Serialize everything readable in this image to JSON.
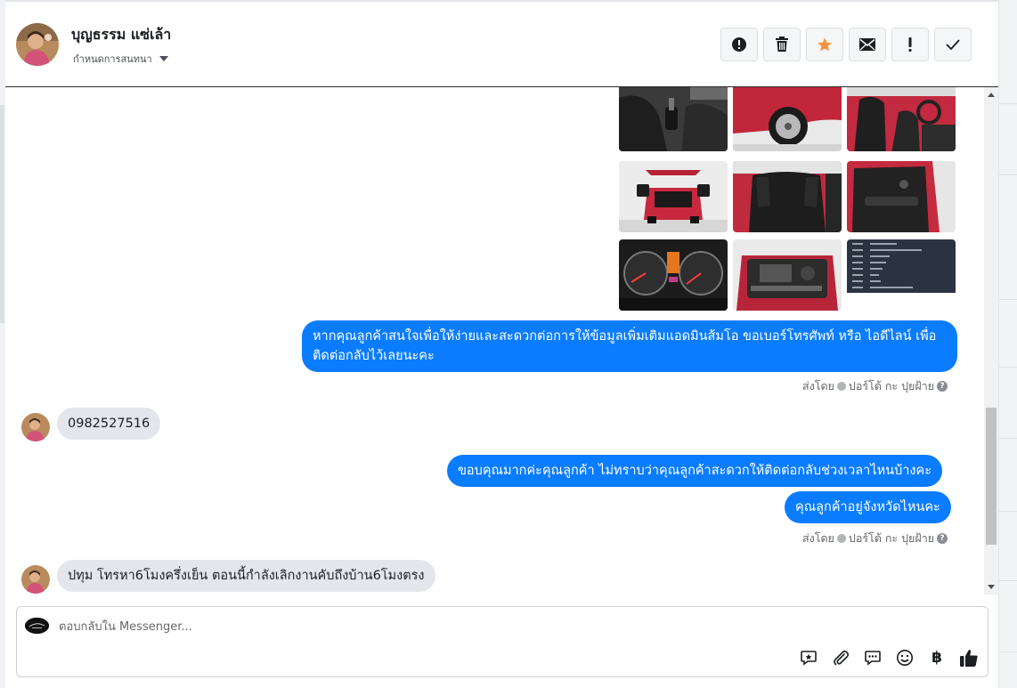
{
  "header": {
    "contact_name": "บุญธรรม แซ่เล้า",
    "assign_label": "กำหนดการสนทนา"
  },
  "toolbar": {
    "icons": [
      "alert-circle-icon",
      "trash-icon",
      "star-icon",
      "envelope-icon",
      "exclamation-icon",
      "check-icon"
    ],
    "star_color": "#f7923b"
  },
  "messages": {
    "out_1": "หากคุณลูกค้าสนใจเพื่อให้ง่ายและสะดวกต่อการให้ข้อมูลเพิ่มเติมแอดมินส้มโอ ขอเบอร์โทรศัพท์ หรือ ไอดีไลน์ เพื่อติดต่อกลับไว้เลยนะคะ",
    "sent_by_1": "ส่งโดย",
    "sender_1": "ปอร์โต้ กะ ปุยฝ้าย",
    "in_1": "0982527516",
    "out_2": "ขอบคุณมากค่ะคุณลูกค้า ไม่ทราบว่าคุณลูกค้าสะดวกให้ติดต่อกลับช่วงเวลาไหนบ้างคะ",
    "out_3": "คุณลูกค้าอยู่จังหวัดไหนคะ",
    "sent_by_2": "ส่งโดย",
    "sender_2": "ปอร์โต้ กะ ปุยฝ้าย",
    "in_2": "ปทุม โทรหา6โมงครึ่งเย็น ตอนนี้กำลังเลิกงานคับถึงบ้าน6โมงตรง"
  },
  "photos": [
    "car-interior-photo",
    "car-wheel-photo",
    "car-front-seats-photo",
    "car-trunk-open-photo",
    "car-rear-seats-photo",
    "car-door-photo",
    "car-dashboard-photo",
    "car-engine-photo",
    "car-spec-sheet-photo"
  ],
  "composer": {
    "placeholder": "ตอบกลับใน Messenger...",
    "icons": [
      "saved-reply-icon",
      "attachment-icon",
      "chat-bubble-icon",
      "emoji-icon",
      "baht-icon",
      "thumbs-up-icon"
    ],
    "baht_symbol": "฿"
  },
  "colors": {
    "accent": "#0a7cff",
    "incoming": "#e4e6eb"
  }
}
